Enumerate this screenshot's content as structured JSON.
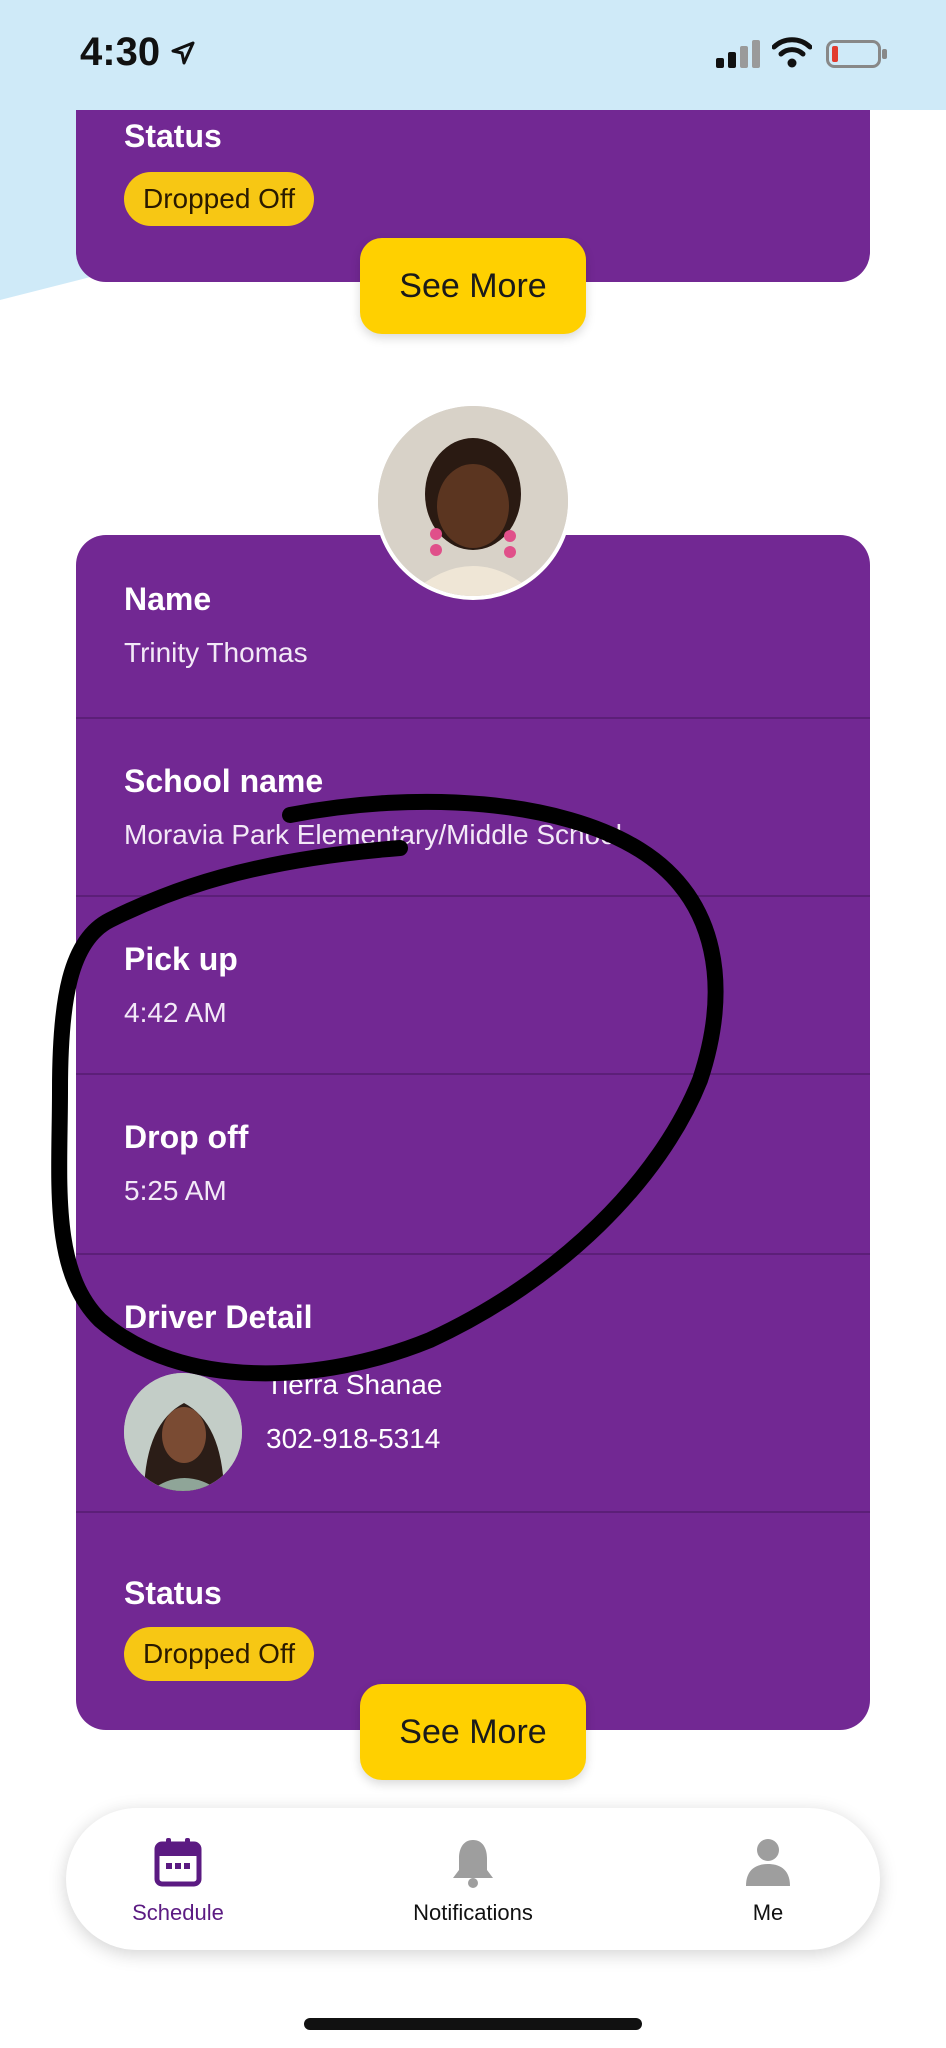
{
  "status_bar": {
    "time": "4:30"
  },
  "top_card": {
    "status_label": "Status",
    "status_value": "Dropped Off",
    "see_more": "See More"
  },
  "student_card": {
    "name_label": "Name",
    "name_value": "Trinity Thomas",
    "school_label": "School name",
    "school_value": "Moravia Park Elementary/Middle School",
    "pickup_label": "Pick up",
    "pickup_value": "4:42 AM",
    "dropoff_label": "Drop off",
    "dropoff_value": "5:25 AM",
    "driver_label": "Driver Detail",
    "driver_name": "Tierra Shanae",
    "driver_phone": "302-918-5314",
    "status_label": "Status",
    "status_value": "Dropped Off",
    "see_more": "See More"
  },
  "tabbar": {
    "items": [
      {
        "label": "Schedule",
        "icon": "calendar-icon",
        "active": true
      },
      {
        "label": "Notifications",
        "icon": "bell-icon",
        "active": false
      },
      {
        "label": "Me",
        "icon": "person-icon",
        "active": false
      }
    ]
  },
  "colors": {
    "card_purple": "#722893",
    "badge_yellow": "#f7c714",
    "button_yellow": "#ffd000",
    "active_tab": "#5b1a82",
    "inactive_tab": "#9e9e9e",
    "status_bar_bg": "#cfeaf8"
  }
}
